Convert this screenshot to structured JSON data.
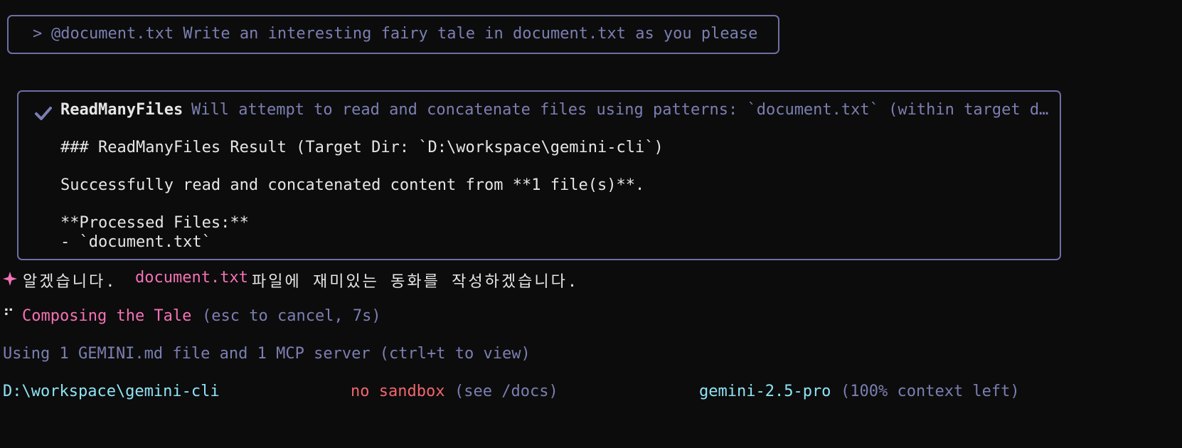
{
  "prompt": {
    "marker": ">",
    "text": "@document.txt Write an interesting fairy tale in document.txt as you please"
  },
  "tool": {
    "name": "ReadManyFiles",
    "description": "Will attempt to read and concatenate files using patterns: `document.txt` (within target d…",
    "result_heading": "### ReadManyFiles Result (Target Dir: `D:\\workspace\\gemini-cli`)",
    "result_summary": "Successfully read and concatenated content from **1 file(s)**.",
    "processed_header": "**Processed Files:**",
    "processed_item": "- `document.txt`"
  },
  "reply": {
    "prefix": "알겠습니다.",
    "filename": "document.txt",
    "suffix": "파일에 재미있는 동화를 작성하겠습니다."
  },
  "status": {
    "spinner": "⠋",
    "label": "Composing the Tale",
    "hint": "(esc to cancel, 7s)"
  },
  "context_info": "Using 1 GEMINI.md file and 1 MCP server (ctrl+t to view)",
  "footer": {
    "cwd": "D:\\workspace\\gemini-cli",
    "sandbox": "no sandbox",
    "sandbox_hint": "(see /docs)",
    "model": "gemini-2.5-pro",
    "context_left": "(100% context left)"
  },
  "colors": {
    "background": "#0c0c0c",
    "border": "#6e6fa6",
    "muted": "#7b7fb2",
    "accent_pink": "#f472b6",
    "accent_cyan": "#8fe3f5",
    "accent_red": "#f2666d"
  }
}
